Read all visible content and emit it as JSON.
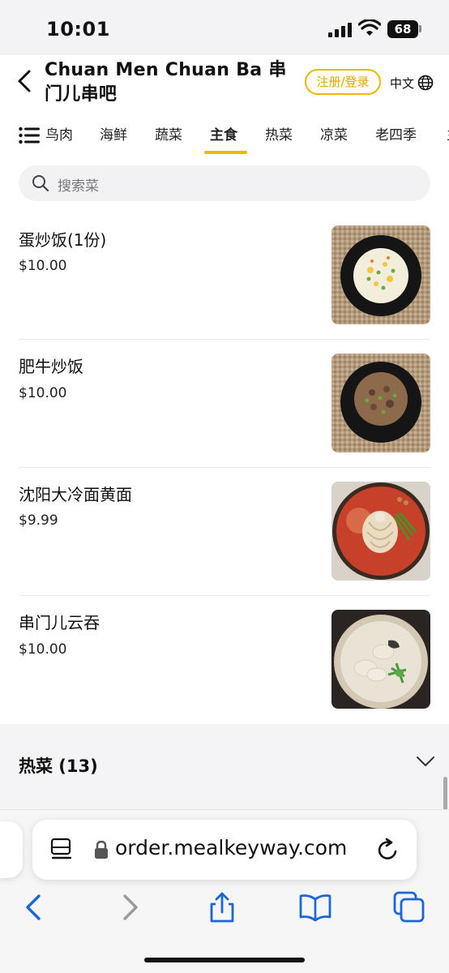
{
  "status_bar": {
    "time": "10:01",
    "battery": "68"
  },
  "header": {
    "title": "Chuan Men Chuan Ba 串门儿串吧",
    "login_label": "注册/登录",
    "lang_label": "中文",
    "icons": [
      "back-icon",
      "globe-icon"
    ]
  },
  "tabs": {
    "items": [
      "鸟肉",
      "海鲜",
      "蔬菜",
      "主食",
      "热菜",
      "凉菜",
      "老四季",
      "主"
    ],
    "active": "主食",
    "accent_color": "#f2b705"
  },
  "search": {
    "placeholder": "搜索菜"
  },
  "menu_items": [
    {
      "name": "蛋炒饭(1份)",
      "price": "$10.00"
    },
    {
      "name": "肥牛炒饭",
      "price": "$10.00"
    },
    {
      "name": "沈阳大冷面黄面",
      "price": "$9.99"
    },
    {
      "name": "串门儿云吞",
      "price": "$10.00"
    }
  ],
  "section": {
    "title": "热菜 (13)"
  },
  "browser": {
    "url": "order.mealkeyway.com",
    "icons": [
      "reader-icon",
      "lock-icon",
      "reload-icon",
      "back-arrow-icon",
      "forward-arrow-icon",
      "share-icon",
      "bookmarks-icon",
      "tabs-icon"
    ]
  }
}
